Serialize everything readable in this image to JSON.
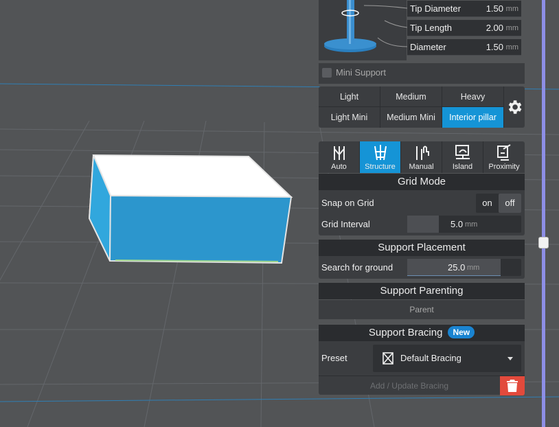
{
  "tip": {
    "rows": [
      {
        "label": "Tip Diameter",
        "value": "1.50",
        "unit": "mm"
      },
      {
        "label": "Tip Length",
        "value": "2.00",
        "unit": "mm"
      },
      {
        "label": "Diameter",
        "value": "1.50",
        "unit": "mm"
      }
    ]
  },
  "mini_support": {
    "label": "Mini Support",
    "checked": false
  },
  "presets": {
    "row1": [
      "Light",
      "Medium",
      "Heavy"
    ],
    "row2": [
      "Light Mini",
      "Medium Mini",
      "Interior pillar"
    ],
    "active": "Interior pillar",
    "settings_icon": "gear-icon"
  },
  "modes": {
    "items": [
      {
        "label": "Auto",
        "icon": "auto-icon"
      },
      {
        "label": "Structure",
        "icon": "structure-icon"
      },
      {
        "label": "Manual",
        "icon": "manual-icon"
      },
      {
        "label": "Island",
        "icon": "island-icon"
      },
      {
        "label": "Proximity",
        "icon": "proximity-icon"
      }
    ],
    "active": "Structure",
    "active_color": "#1594d6"
  },
  "grid_mode": {
    "title": "Grid Mode",
    "snap_label": "Snap on Grid",
    "snap_on": "on",
    "snap_off": "off",
    "snap_selected": "off",
    "interval_label": "Grid Interval",
    "interval_value": "5.0",
    "interval_unit": "mm",
    "interval_fill": 0.28
  },
  "support_placement": {
    "title": "Support Placement",
    "search_label": "Search for ground",
    "search_value": "25.0",
    "search_unit": "mm",
    "search_fill": 0.82
  },
  "support_parenting": {
    "title": "Support Parenting",
    "parent_label": "Parent"
  },
  "support_bracing": {
    "title": "Support Bracing",
    "badge": "New",
    "badge_color": "#1a84d1",
    "preset_label": "Preset",
    "preset_value": "Default Bracing",
    "add_update_label": "Add / Update Bracing",
    "delete_color": "#e24a3c"
  },
  "viewport": {
    "background": "#525456",
    "model_color": "#2c9fd6",
    "slider_color": "#8d8ee6"
  }
}
